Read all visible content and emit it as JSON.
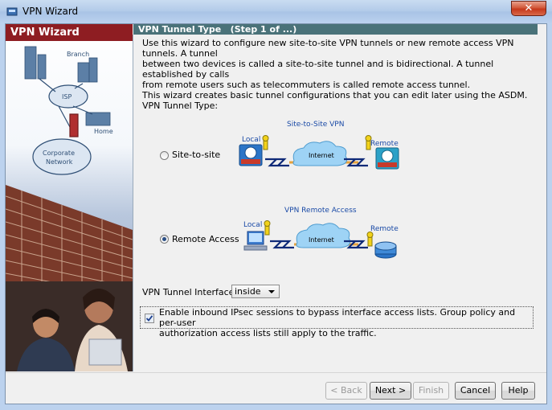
{
  "window": {
    "title": "VPN Wizard",
    "close_glyph": "✕"
  },
  "banner": {
    "title": "VPN Wizard",
    "labels": {
      "branch": "Branch",
      "isp": "ISP",
      "home": "Home",
      "corporate": "Corporate",
      "network": "Network"
    }
  },
  "step": {
    "title": "VPN Tunnel Type",
    "step_label": "(Step 1 of ...)"
  },
  "intro": {
    "line1": "Use this wizard to configure new site-to-site VPN tunnels or new remote access VPN tunnels. A tunnel",
    "line2": "between two devices is called a site-to-site tunnel and is bidirectional. A tunnel established by calls",
    "line3": "from remote users such as telecommuters is called remote access tunnel.",
    "line4": "This wizard creates basic tunnel configurations that you can edit later using the ASDM."
  },
  "tunnel_type": {
    "label": "VPN Tunnel Type:",
    "options": [
      {
        "label": "Site-to-site",
        "selected": false
      },
      {
        "label": "Remote Access",
        "selected": true
      }
    ],
    "diagram_site": {
      "title": "Site-to-Site VPN",
      "local": "Local",
      "remote": "Remote",
      "cloud": "Internet"
    },
    "diagram_remote": {
      "title": "VPN Remote Access",
      "local": "Local",
      "remote": "Remote",
      "cloud": "Internet"
    }
  },
  "interface": {
    "label": "VPN Tunnel Interface:",
    "value": "inside"
  },
  "bypass": {
    "checked": true,
    "line1": "Enable inbound IPsec sessions to bypass interface access lists. Group policy and per-user",
    "line2": "authorization access lists still apply to the traffic."
  },
  "buttons": {
    "back": "< Back",
    "next": "Next >",
    "finish": "Finish",
    "cancel": "Cancel",
    "help": "Help"
  },
  "colors": {
    "banner_red": "#8e1d22",
    "header_teal": "#4a7279",
    "diagram_blue": "#1a4aa6"
  }
}
